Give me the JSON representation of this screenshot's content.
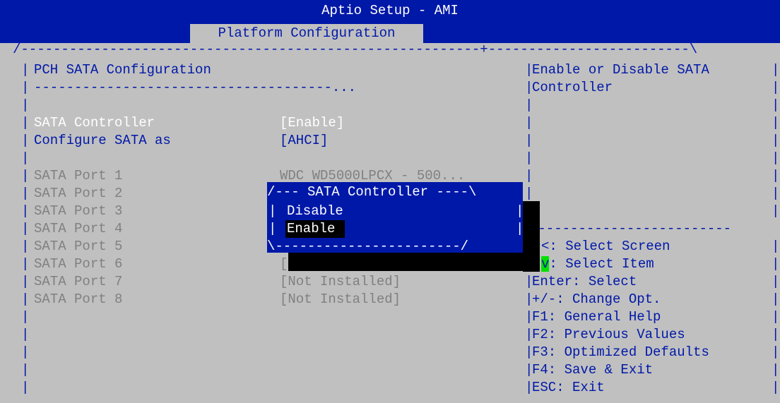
{
  "header": {
    "title": "Aptio Setup - AMI",
    "active_tab": "Platform Configuration"
  },
  "main": {
    "section_title": "PCH SATA Configuration",
    "separator": "-------------------------------------...",
    "settings": [
      {
        "label": "SATA Controller",
        "value": "[Enable]"
      },
      {
        "label": "Configure SATA as",
        "value": "[AHCI]"
      }
    ],
    "ports": [
      {
        "label": "SATA Port 1",
        "value": "WDC WD5000LPCX - 500..."
      },
      {
        "label": "SATA Port 2",
        "value": ""
      },
      {
        "label": "SATA Port 3",
        "value": ""
      },
      {
        "label": "SATA Port 4",
        "value": ""
      },
      {
        "label": "SATA Port 5",
        "value": ""
      },
      {
        "label": "SATA Port 6",
        "value": "["
      },
      {
        "label": "SATA Port 7",
        "value": "[Not Installed]"
      },
      {
        "label": "SATA Port 8",
        "value": "[Not Installed]"
      }
    ]
  },
  "popup": {
    "title": "/--- SATA Controller ----\\",
    "options": [
      "Disable",
      "Enable"
    ],
    "selected": "Enable",
    "bottom": "\\-----------------------/"
  },
  "help": {
    "description_line1": "Enable or Disable SATA",
    "description_line2": "Controller",
    "keys": [
      "<: Select Screen",
      "v: Select Item",
      "Enter: Select",
      "+/-: Change Opt.",
      "F1: General Help",
      "F2: Previous Values",
      "F3: Optimized Defaults",
      "F4: Save & Exit",
      "ESC: Exit"
    ],
    "select_item_key": "v",
    "select_item_text": ": Select Item"
  },
  "colors": {
    "background": "#c0c0c0",
    "bios_blue": "#0018a8",
    "highlight_green": "#00e000",
    "shadow": "#000000"
  }
}
